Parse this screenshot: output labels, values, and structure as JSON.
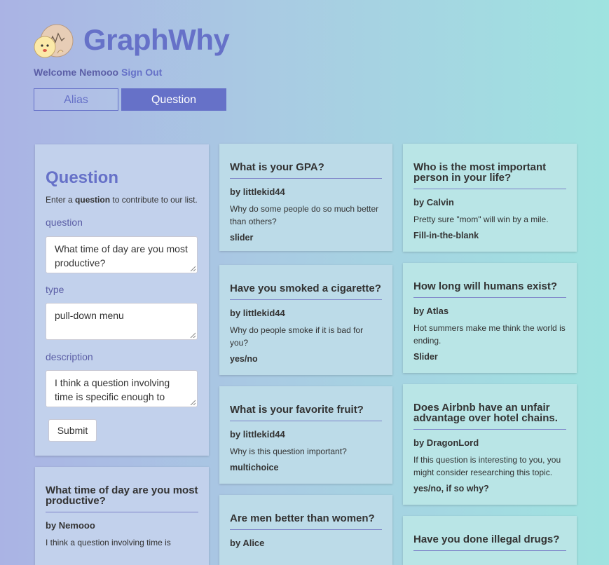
{
  "app": {
    "brand": "GraphWhy"
  },
  "header": {
    "welcome_text": "Welcome Nemooo",
    "sign_out": "Sign Out"
  },
  "tabs": [
    {
      "label": "Alias"
    },
    {
      "label": "Question"
    }
  ],
  "form": {
    "heading": "Question",
    "intro_pre": "Enter a ",
    "intro_bold": "question",
    "intro_post": " to contribute to our list.",
    "question_label": "question",
    "question_value": "What time of day are you most productive?",
    "type_label": "type",
    "type_value": "pull-down menu",
    "description_label": "description",
    "description_value": "I think a question involving time is specific enough to have i",
    "submit_label": "Submit"
  },
  "col1_cards": [
    {
      "title": "What time of day are you most productive?",
      "author": "Nemooo",
      "description": "I think a question involving time is"
    }
  ],
  "col2_cards": [
    {
      "title": "What is your GPA?",
      "author": "littlekid44",
      "description": "Why do some people do so much better than others?",
      "type": "slider"
    },
    {
      "title": "Have you smoked a cigarette?",
      "author": "littlekid44",
      "description": "Why do people smoke if it is bad for you?",
      "type": "yes/no"
    },
    {
      "title": "What is your favorite fruit?",
      "author": "littlekid44",
      "description": "Why is this question important?",
      "type": "multichoice"
    },
    {
      "title": "Are men better than women?",
      "author": "Alice"
    }
  ],
  "col3_cards": [
    {
      "title": "Who is the most important person in your life?",
      "author": "Calvin",
      "description": "Pretty sure \"mom\" will win by a mile.",
      "type": "Fill-in-the-blank"
    },
    {
      "title": "How long will humans exist?",
      "author": "Atlas",
      "description": "Hot summers make me think the world is ending.",
      "type": "Slider"
    },
    {
      "title": "Does Airbnb have an unfair advantage over hotel chains.",
      "author": "DragonLord",
      "description": "If this question is interesting to you, you might consider researching this topic.",
      "type": "yes/no, if so why?"
    },
    {
      "title": "Have you done illegal drugs?"
    }
  ],
  "by_prefix": "by ",
  "colors": {
    "accent": "#6671c8",
    "label": "#5b5ea6"
  }
}
